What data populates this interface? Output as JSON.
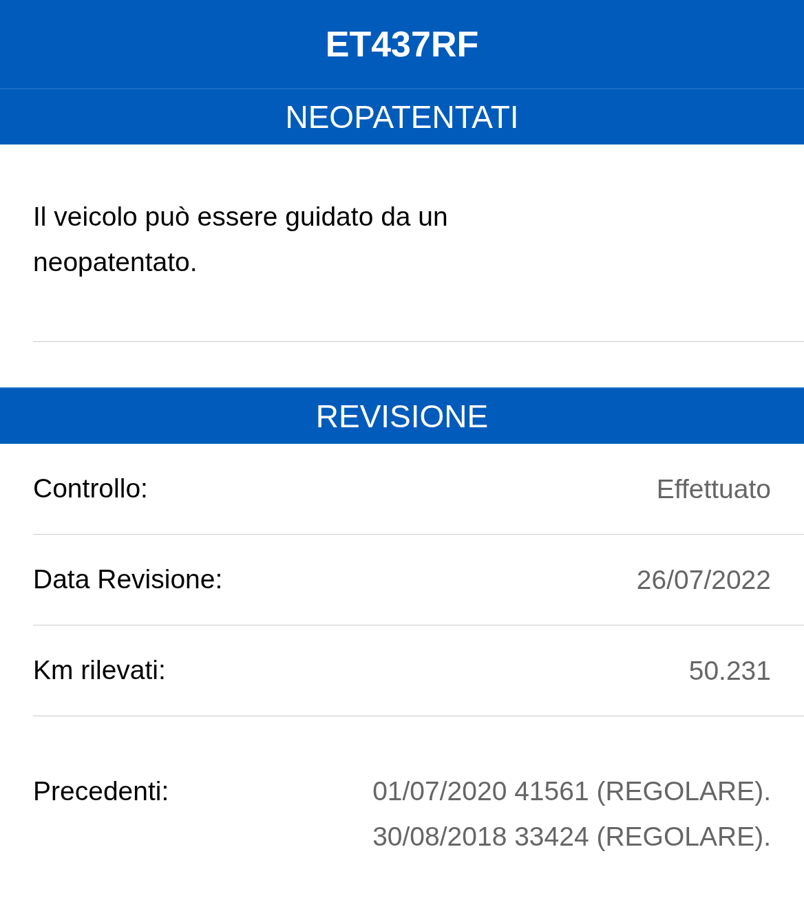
{
  "title": "ET437RF",
  "sections": [
    {
      "heading": "NEOPATENTATI",
      "kind": "text",
      "text": "Il veicolo può essere guidato da un neopatentato."
    },
    {
      "heading": "REVISIONE",
      "kind": "fields",
      "rows": [
        {
          "label": "Controllo:",
          "value_lines": [
            "Effettuato"
          ]
        },
        {
          "label": "Data Revisione:",
          "value_lines": [
            "26/07/2022"
          ]
        },
        {
          "label": "Km rilevati:",
          "value_lines": [
            "50.231"
          ]
        },
        {
          "label": "Precedenti:",
          "value_lines": [
            "01/07/2020 41561 (REGOLARE).",
            "30/08/2018 33424 (REGOLARE)."
          ]
        }
      ]
    }
  ]
}
